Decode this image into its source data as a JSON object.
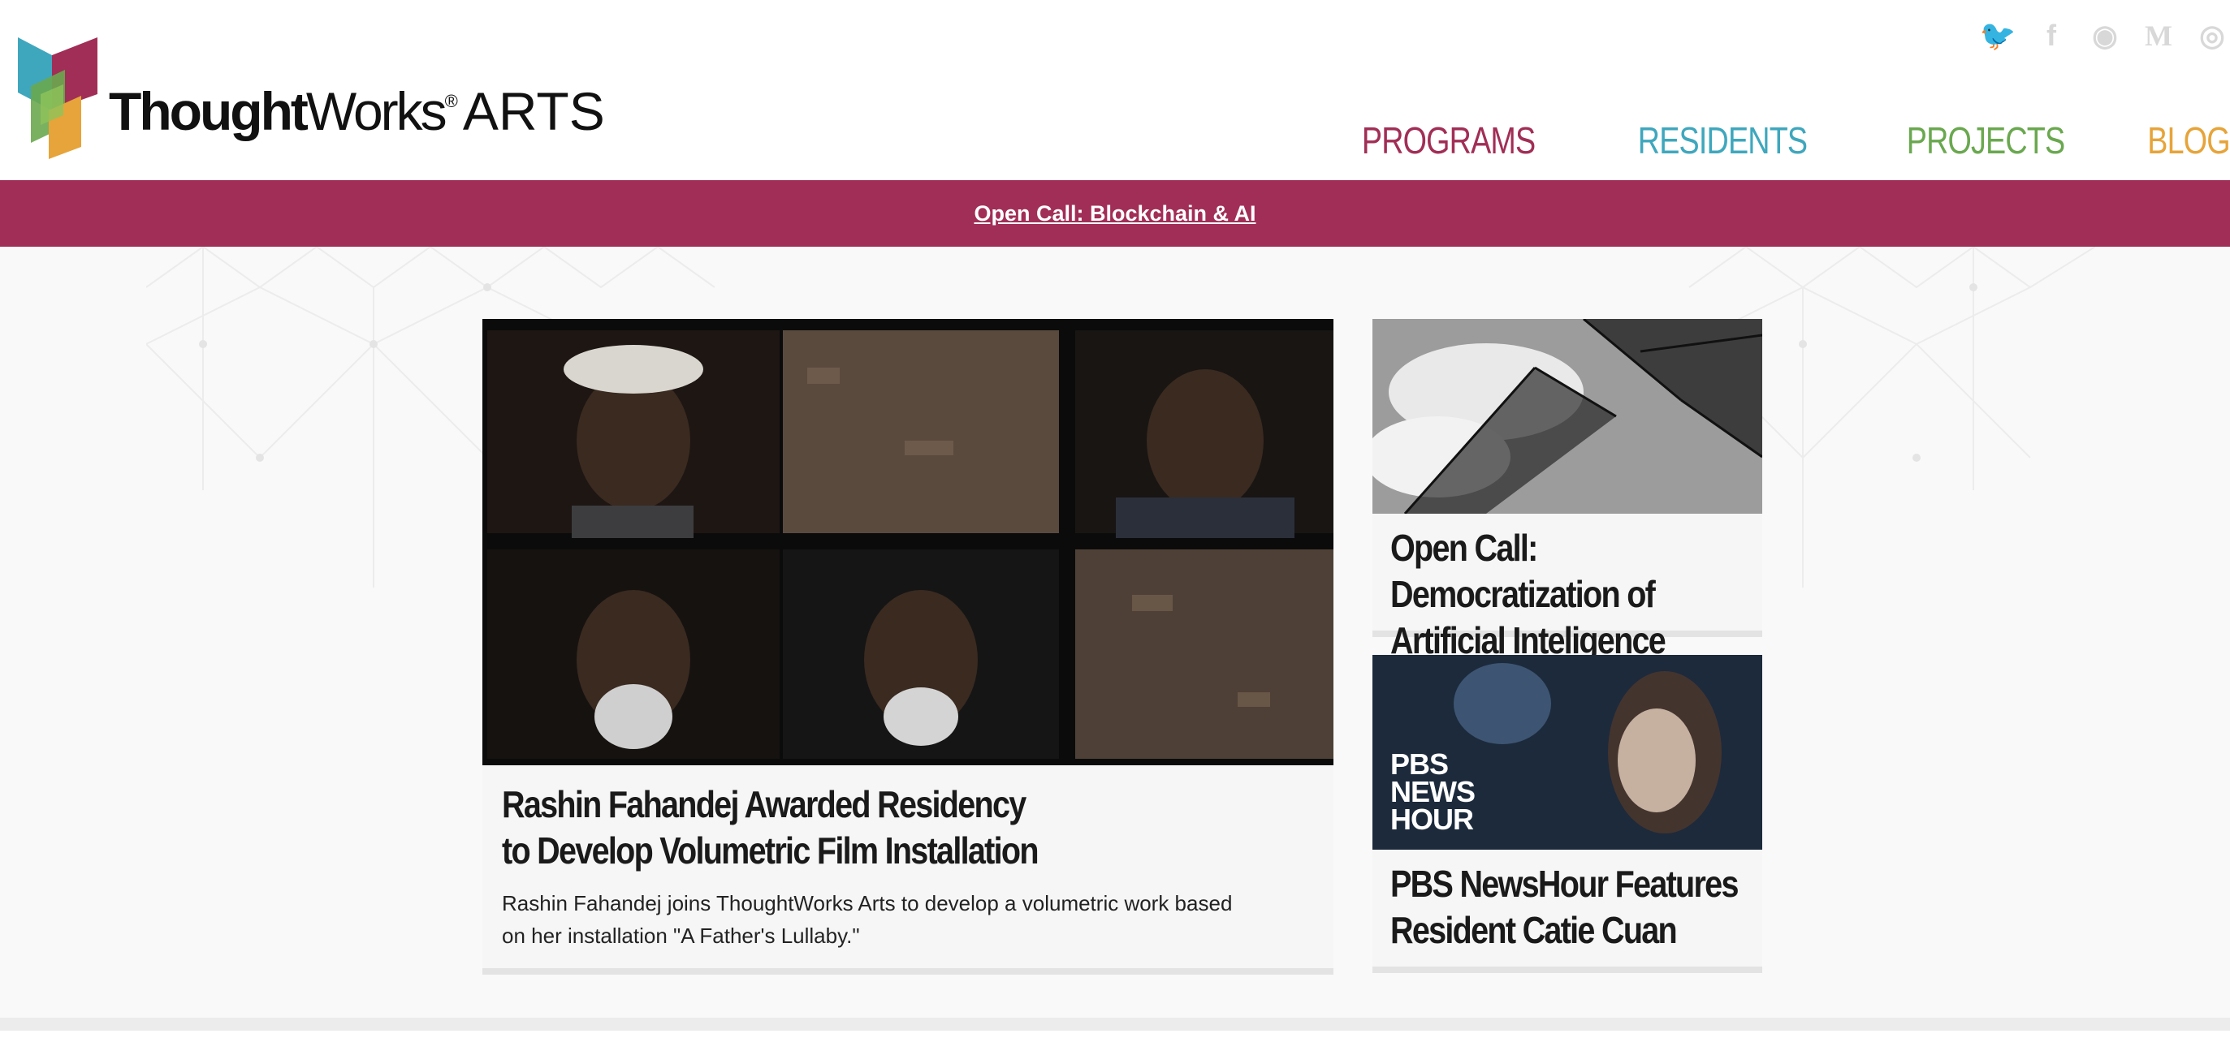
{
  "logo": {
    "brand_bold": "Thought",
    "brand_regular": "Works",
    "registered": "®",
    "arts": "ARTS"
  },
  "social": [
    {
      "name": "twitter-icon",
      "glyph": "🐦"
    },
    {
      "name": "facebook-icon",
      "glyph": "f"
    },
    {
      "name": "github-icon",
      "glyph": "◉"
    },
    {
      "name": "medium-icon",
      "glyph": "M"
    },
    {
      "name": "instagram-icon",
      "glyph": "◎"
    }
  ],
  "nav": [
    {
      "label": "PROGRAMS",
      "color": "#a12e56"
    },
    {
      "label": "RESIDENTS",
      "color": "#3fa7bd"
    },
    {
      "label": "PROJECTS",
      "color": "#6aa84f"
    },
    {
      "label": "BLOG",
      "color": "#e6a43a"
    }
  ],
  "banner": {
    "link": "Open Call: Blockchain & AI",
    "color": "#a12e56"
  },
  "featured": {
    "title": "Rashin Fahandej Awarded Residency to Develop Volumetric Film Installation",
    "excerpt": "Rashin Fahandej joins ThoughtWorks Arts to develop a volumetric work based on her installation \"A Father's Lullaby.\""
  },
  "side_cards": [
    {
      "title": "Open Call: Democratization of Artificial Inteligence"
    },
    {
      "title": "PBS NewsHour Features Resident Catie Cuan",
      "badge": "PBS NEWS HOUR"
    }
  ]
}
